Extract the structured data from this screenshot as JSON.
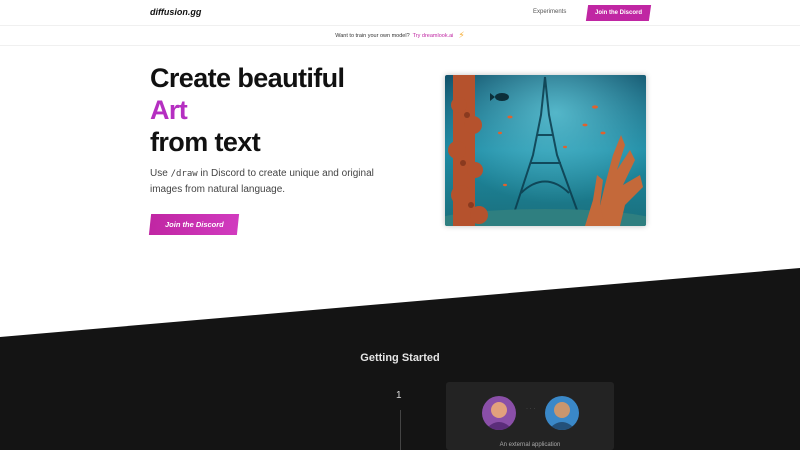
{
  "nav": {
    "brand": "diffusion.gg",
    "link_experiments": "Experiments",
    "join_button": "Join the Discord"
  },
  "banner": {
    "text": "Want to train your own model?",
    "link": "Try dreamlook.ai",
    "icon": "lightning-bolt-icon"
  },
  "hero": {
    "line1": "Create beautiful",
    "line2": "Art",
    "line3": "from text",
    "desc_before": "Use ",
    "desc_code": "/draw",
    "desc_after": " in Discord to create unique and original images from natural language.",
    "button": "Join the Discord",
    "image_alt_icon": "underwater-eiffel-tower-image",
    "accent_color": "#b52fc1"
  },
  "getting_started": {
    "title": "Getting Started",
    "step_number": "1",
    "card_caption": "An external application"
  },
  "colors": {
    "brand_magenta": "#c026a3",
    "dark_section": "#141414",
    "card_bg": "#232323"
  }
}
